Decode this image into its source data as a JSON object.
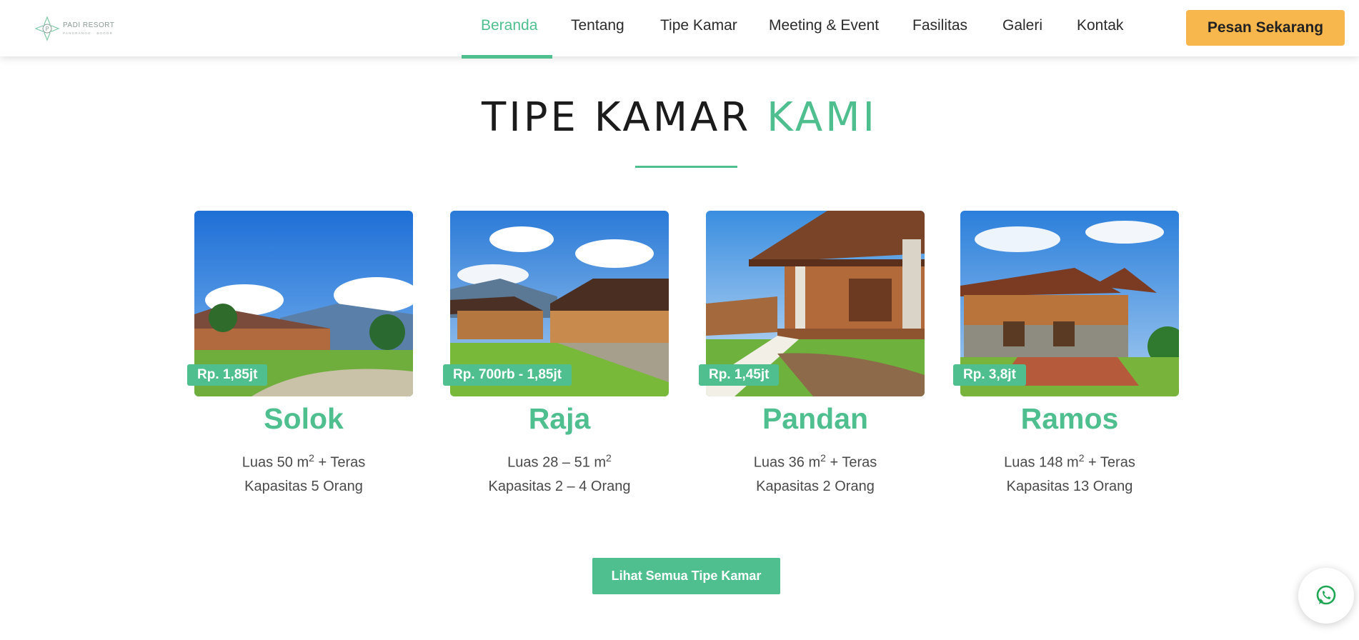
{
  "brand": {
    "name": "PADI RESORT",
    "tagline": "PANGRANGO · BOGOR",
    "colors": {
      "accent": "#4fbf8f",
      "cta": "#f8b74c",
      "text": "#2b2b2b"
    }
  },
  "nav": {
    "items": [
      {
        "label": "Beranda",
        "active": true
      },
      {
        "label": "Tentang",
        "active": false
      },
      {
        "label": "Tipe Kamar",
        "active": false
      },
      {
        "label": "Meeting & Event",
        "active": false
      },
      {
        "label": "Fasilitas",
        "active": false
      },
      {
        "label": "Galeri",
        "active": false
      },
      {
        "label": "Kontak",
        "active": false
      }
    ],
    "cta_label": "Pesan Sekarang"
  },
  "section": {
    "title_part1": "TIPE KAMAR",
    "title_part2": "KAMI"
  },
  "rooms": [
    {
      "name": "Solok",
      "price": "Rp. 1,85jt",
      "area_prefix": "Luas 50 m",
      "area_suffix": " + Teras",
      "capacity": "Kapasitas 5 Orang"
    },
    {
      "name": "Raja",
      "price": "Rp. 700rb - 1,85jt",
      "area_prefix": "Luas 28 – 51 m",
      "area_suffix": "",
      "capacity": "Kapasitas 2 – 4 Orang"
    },
    {
      "name": "Pandan",
      "price": "Rp. 1,45jt",
      "area_prefix": "Luas 36 m",
      "area_suffix": " + Teras",
      "capacity": "Kapasitas 2 Orang"
    },
    {
      "name": "Ramos",
      "price": "Rp. 3,8jt",
      "area_prefix": "Luas 148 m",
      "area_suffix": " + Teras",
      "capacity": "Kapasitas 13 Orang"
    }
  ],
  "superscript": "2",
  "all_rooms_label": "Lihat Semua Tipe Kamar",
  "icons": {
    "whatsapp": "whatsapp-icon",
    "logo": "lotus-logo-icon"
  }
}
